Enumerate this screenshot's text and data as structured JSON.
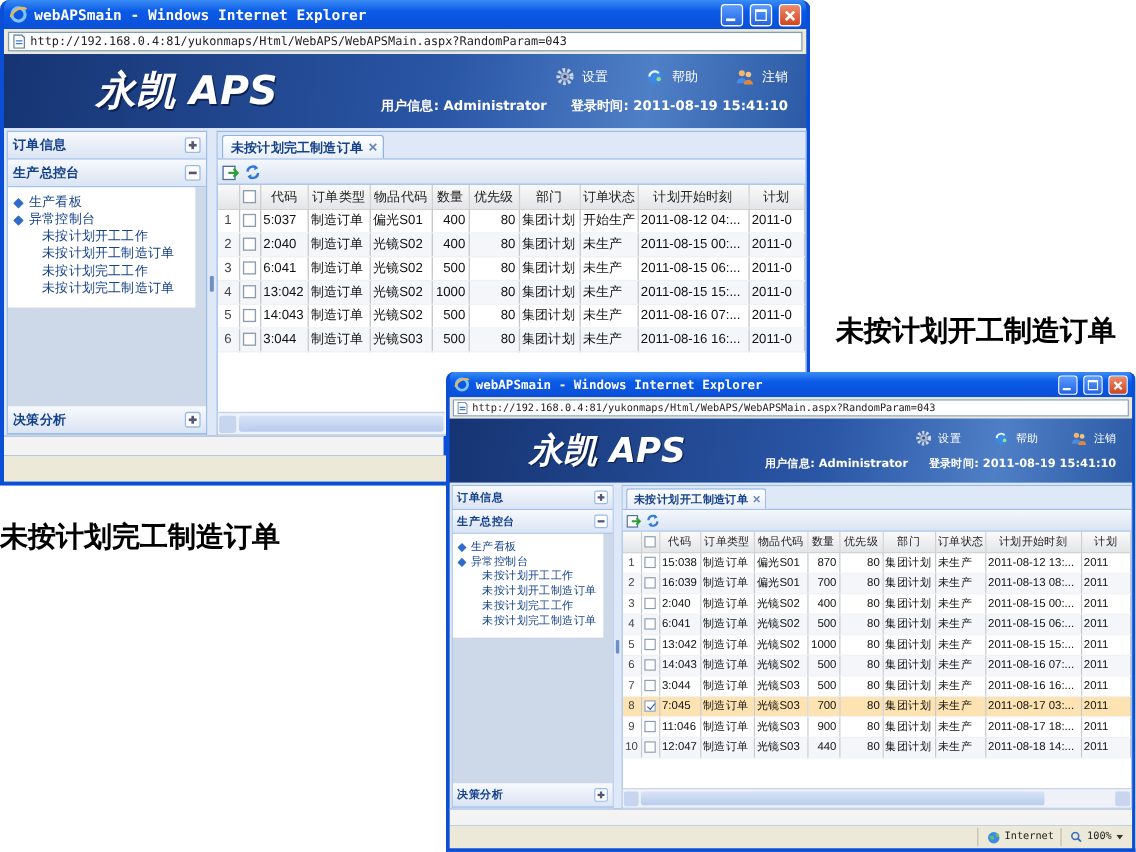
{
  "windows": [
    {
      "title": "webAPSmain - Windows Internet Explorer",
      "url": "http://192.168.0.4:81/yukonmaps/Html/WebAPS/WebAPSMain.aspx?RandomParam=043",
      "app": {
        "logo": "永凯 APS",
        "links": [
          {
            "label": "设置"
          },
          {
            "label": "帮助"
          },
          {
            "label": "注销"
          }
        ],
        "user": "用户信息: Administrator",
        "login": "登录时间: 2011-08-19 15:41:10"
      },
      "sidebar": [
        {
          "label": "订单信息",
          "expanded": false
        },
        {
          "label": "生产总控台",
          "expanded": true,
          "tree": [
            {
              "label": "生产看板"
            },
            {
              "label": "异常控制台",
              "children": [
                {
                  "label": "未按计划开工工作"
                },
                {
                  "label": "未按计划开工制造订单"
                },
                {
                  "label": "未按计划完工工作"
                },
                {
                  "label": "未按计划完工制造订单"
                }
              ]
            }
          ]
        },
        {
          "label": "决策分析",
          "expanded": false
        }
      ],
      "tabs": [
        {
          "label": "未按计划完工制造订单",
          "selected": true
        }
      ],
      "table": {
        "select_all": false,
        "columns": [
          "代码",
          "订单类型",
          "物品代码",
          "数量",
          "优先级",
          "部门",
          "订单状态",
          "计划开始时刻",
          "计划"
        ],
        "rows": [
          {
            "num": "1",
            "checked": false,
            "selected": false,
            "cells": [
              "5:037",
              "制造订单",
              "偏光S01",
              "400",
              "80",
              "集团计划",
              "开始生产",
              "2011-08-12 04:...",
              "2011-0"
            ]
          },
          {
            "num": "2",
            "checked": false,
            "selected": false,
            "cells": [
              "2:040",
              "制造订单",
              "光镜S02",
              "400",
              "80",
              "集团计划",
              "未生产",
              "2011-08-15 00:...",
              "2011-0"
            ]
          },
          {
            "num": "3",
            "checked": false,
            "selected": false,
            "cells": [
              "6:041",
              "制造订单",
              "光镜S02",
              "500",
              "80",
              "集团计划",
              "未生产",
              "2011-08-15 06:...",
              "2011-0"
            ]
          },
          {
            "num": "4",
            "checked": false,
            "selected": false,
            "cells": [
              "13:042",
              "制造订单",
              "光镜S02",
              "1000",
              "80",
              "集团计划",
              "未生产",
              "2011-08-15 15:...",
              "2011-0"
            ]
          },
          {
            "num": "5",
            "checked": false,
            "selected": false,
            "cells": [
              "14:043",
              "制造订单",
              "光镜S02",
              "500",
              "80",
              "集团计划",
              "未生产",
              "2011-08-16 07:...",
              "2011-0"
            ]
          },
          {
            "num": "6",
            "checked": false,
            "selected": false,
            "cells": [
              "3:044",
              "制造订单",
              "光镜S03",
              "500",
              "80",
              "集团计划",
              "未生产",
              "2011-08-16 16:...",
              "2011-0"
            ]
          }
        ]
      }
    },
    {
      "title": "webAPSmain - Windows Internet Explorer",
      "url": "http://192.168.0.4:81/yukonmaps/Html/WebAPS/WebAPSMain.aspx?RandomParam=043",
      "app": {
        "logo": "永凯 APS",
        "links": [
          {
            "label": "设置"
          },
          {
            "label": "帮助"
          },
          {
            "label": "注销"
          }
        ],
        "user": "用户信息: Administrator",
        "login": "登录时间: 2011-08-19 15:41:10"
      },
      "sidebar": [
        {
          "label": "订单信息",
          "expanded": false
        },
        {
          "label": "生产总控台",
          "expanded": true,
          "tree": [
            {
              "label": "生产看板"
            },
            {
              "label": "异常控制台",
              "children": [
                {
                  "label": "未按计划开工工作"
                },
                {
                  "label": "未按计划开工制造订单"
                },
                {
                  "label": "未按计划完工工作"
                },
                {
                  "label": "未按计划完工制造订单"
                }
              ]
            }
          ]
        },
        {
          "label": "决策分析",
          "expanded": false
        }
      ],
      "tabs": [
        {
          "label": "未按计划开工制造订单",
          "selected": true
        }
      ],
      "table": {
        "select_all": false,
        "columns": [
          "代码",
          "订单类型",
          "物品代码",
          "数量",
          "优先级",
          "部门",
          "订单状态",
          "计划开始时刻",
          "计划"
        ],
        "rows": [
          {
            "num": "1",
            "checked": false,
            "selected": false,
            "cells": [
              "15:038",
              "制造订单",
              "偏光S01",
              "870",
              "80",
              "集团计划",
              "未生产",
              "2011-08-12 13:...",
              "2011"
            ]
          },
          {
            "num": "2",
            "checked": false,
            "selected": false,
            "cells": [
              "16:039",
              "制造订单",
              "偏光S01",
              "700",
              "80",
              "集团计划",
              "未生产",
              "2011-08-13 08:...",
              "2011"
            ]
          },
          {
            "num": "3",
            "checked": false,
            "selected": false,
            "cells": [
              "2:040",
              "制造订单",
              "光镜S02",
              "400",
              "80",
              "集团计划",
              "未生产",
              "2011-08-15 00:...",
              "2011"
            ]
          },
          {
            "num": "4",
            "checked": false,
            "selected": false,
            "cells": [
              "6:041",
              "制造订单",
              "光镜S02",
              "500",
              "80",
              "集团计划",
              "未生产",
              "2011-08-15 06:...",
              "2011"
            ]
          },
          {
            "num": "5",
            "checked": false,
            "selected": false,
            "cells": [
              "13:042",
              "制造订单",
              "光镜S02",
              "1000",
              "80",
              "集团计划",
              "未生产",
              "2011-08-15 15:...",
              "2011"
            ]
          },
          {
            "num": "6",
            "checked": false,
            "selected": false,
            "cells": [
              "14:043",
              "制造订单",
              "光镜S02",
              "500",
              "80",
              "集团计划",
              "未生产",
              "2011-08-16 07:...",
              "2011"
            ]
          },
          {
            "num": "7",
            "checked": false,
            "selected": false,
            "cells": [
              "3:044",
              "制造订单",
              "光镜S03",
              "500",
              "80",
              "集团计划",
              "未生产",
              "2011-08-16 16:...",
              "2011"
            ]
          },
          {
            "num": "8",
            "checked": true,
            "selected": true,
            "cells": [
              "7:045",
              "制造订单",
              "光镜S03",
              "700",
              "80",
              "集团计划",
              "未生产",
              "2011-08-17 03:...",
              "2011"
            ]
          },
          {
            "num": "9",
            "checked": false,
            "selected": false,
            "cells": [
              "11:046",
              "制造订单",
              "光镜S03",
              "900",
              "80",
              "集团计划",
              "未生产",
              "2011-08-17 18:...",
              "2011"
            ]
          },
          {
            "num": "10",
            "checked": false,
            "selected": false,
            "cells": [
              "12:047",
              "制造订单",
              "光镜S03",
              "440",
              "80",
              "集团计划",
              "未生产",
              "2011-08-18 14:...",
              "2011"
            ]
          }
        ]
      },
      "status_bar": {
        "zone": "Internet",
        "zoom": "100%"
      }
    }
  ],
  "captions": [
    {
      "text": "未按计划开工制造订单"
    },
    {
      "text": "未按计划完工制造订单"
    }
  ]
}
